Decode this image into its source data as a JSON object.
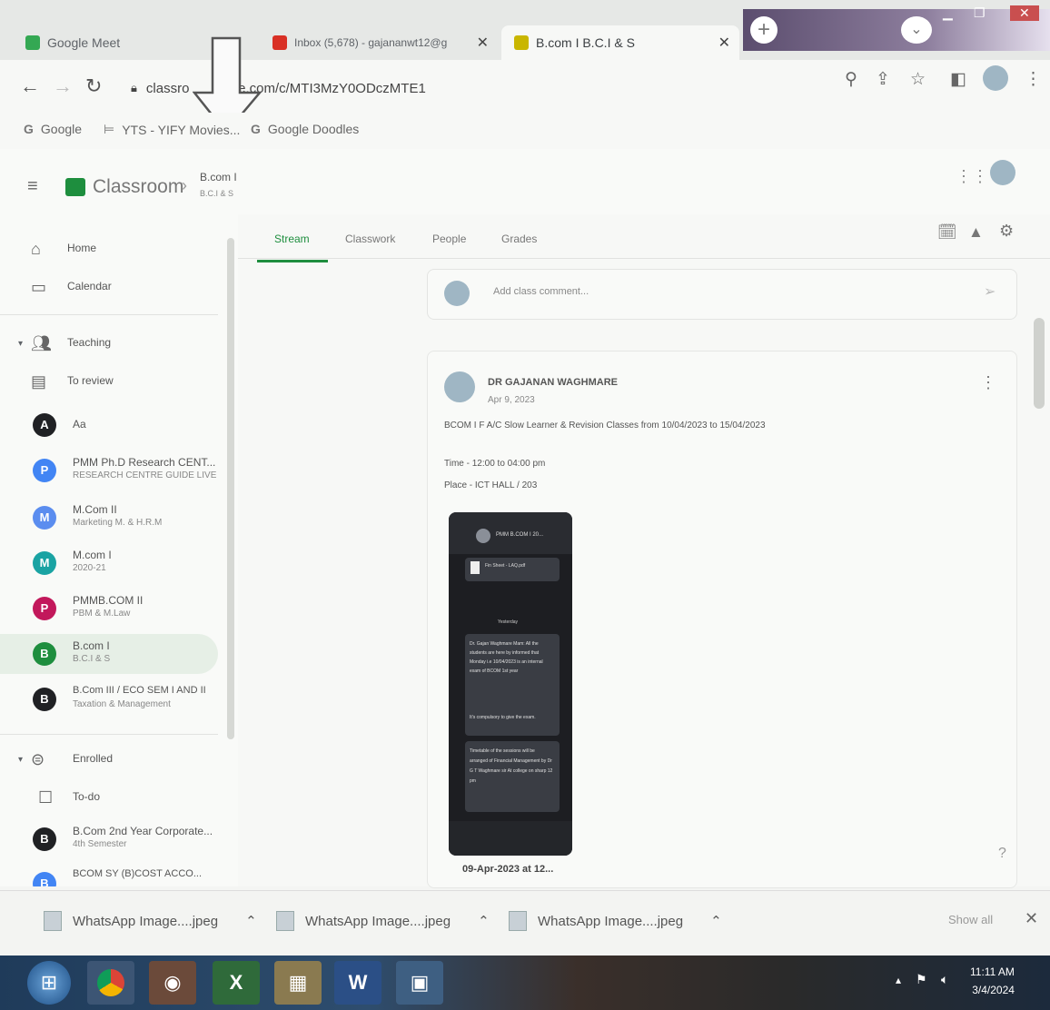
{
  "browser": {
    "tabs": [
      {
        "title": "Google Meet",
        "favicon_color": "#34a853"
      },
      {
        "title": "Inbox (5,678) - gajananwt12@g",
        "favicon_color": "#d93025"
      },
      {
        "title": "B.com I B.C.I & S",
        "favicon_color": "#1e8e3e"
      }
    ],
    "url": "classroom.google.com/c/MTI3MzY0ODczMTE1",
    "url_prefix": "classro",
    "url_suffix": "gle.com/c/MTI3MzY0ODczMTE1",
    "bookmarks": [
      "Google",
      "YTS - YIFY Movies...",
      "Google Doodles"
    ]
  },
  "classroom": {
    "app_name": "Classroom",
    "class_title": "B.com I",
    "class_subtitle": "B.C.I & S",
    "tabs": [
      "Stream",
      "Classwork",
      "People",
      "Grades"
    ],
    "active_tab": "Stream",
    "comment_placeholder": "Add class comment..."
  },
  "sidebar": {
    "home": "Home",
    "calendar": "Calendar",
    "teaching": "Teaching",
    "to_review": "To review",
    "classes": [
      {
        "letter": "A",
        "title": "Aa",
        "subtitle": "",
        "color": "#202124"
      },
      {
        "letter": "P",
        "title": "PMM Ph.D Research CENT...",
        "subtitle": "RESEARCH CENTRE GUIDE LIVE",
        "color": "#4285f4"
      },
      {
        "letter": "M",
        "title": "M.Com II",
        "subtitle": "Marketing M. & H.R.M",
        "color": "#5b8def"
      },
      {
        "letter": "M",
        "title": "M.com I",
        "subtitle": "2020-21",
        "color": "#1aa3a3"
      },
      {
        "letter": "P",
        "title": "PMMB.COM II",
        "subtitle": "PBM & M.Law",
        "color": "#c2185b"
      },
      {
        "letter": "B",
        "title": "B.com I",
        "subtitle": "B.C.I & S",
        "color": "#1e8e3e"
      },
      {
        "letter": "B",
        "title": "B.Com III / ECO SEM I AND II",
        "subtitle": "Taxation & Management",
        "color": "#202124"
      }
    ],
    "enrolled": "Enrolled",
    "todo": "To-do",
    "enrolled_classes": [
      {
        "letter": "B",
        "title": "B.Com 2nd Year Corporate...",
        "subtitle": "4th Semester",
        "color": "#202124"
      },
      {
        "letter": "B",
        "title": "BCOM SY (B)COST ACCO...",
        "subtitle": "",
        "color": "#4285f4"
      }
    ]
  },
  "post": {
    "author": "DR GAJANAN WAGHMARE",
    "date": "Apr 9, 2023",
    "body": "BCOM I F A/C Slow Learner & Revision Classes from 10/04/2023 to 15/04/2023",
    "time_line": "Time - 12:00 to 04:00 pm",
    "place_line": "Place - ICT HALL / 203",
    "attachment_caption": "09-Apr-2023 at 12...",
    "phone_header": "PMM B.COM I 20...",
    "phone_file": "Fin Sheet - LAQ.pdf",
    "phone_label": "Yesterday",
    "phone_msg1": "Dr. Gajan Waghmare Mam: All the students are here by informed that Monday i.e 10/04/2023 is an internal exam of BCOM 1st year",
    "phone_msg1b": "It's compulsory to give the exam.",
    "phone_msg2": "Timetable of the sessions will be arranged of Financial Management by Dr G T Waghmare sir At college on sharp 12 pm"
  },
  "downloads": {
    "items": [
      "WhatsApp Image....jpeg",
      "WhatsApp Image....jpeg",
      "WhatsApp Image....jpeg"
    ],
    "show_all": "Show all"
  },
  "taskbar": {
    "time": "11:11 AM",
    "date": "3/4/2024"
  }
}
